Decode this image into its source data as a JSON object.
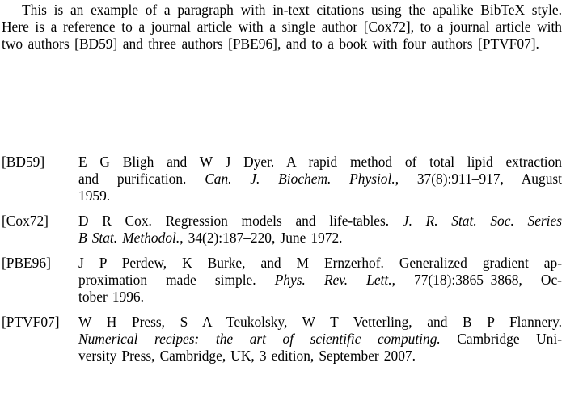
{
  "document": {
    "background_color": "#ffffff",
    "text_color": "#000000",
    "intro": {
      "text": "This is an example of a paragraph with in-text citations using the apalike BibTeX style. Here is a reference to a journal article with a single author [Cox72], to a journal article with two authors [BD59] and three authors [PBE96], and to a book with four authors [PTVF07]."
    },
    "bibliography": {
      "entries": [
        {
          "label": "[BD59]",
          "full_text": "E G Bligh and W J Dyer. A rapid method of total lipid extraction and purification. Can. J. Biochem. Physiol., 37(8):911–917, August 1959.",
          "authors": "E G Bligh and W J Dyer.",
          "title": "A rapid method of total lipid extraction and purification.",
          "journal": "Can. J. Biochem. Physiol.",
          "volume_issue_pages": "37(8):911–917",
          "date": "August 1959.",
          "lines": [
            {
              "before_italic": "E G Bligh and W J Dyer. A rapid method of total lipid extraction",
              "italic": "",
              "after_italic": ""
            },
            {
              "before_italic": "and purification. ",
              "italic": "Can. J. Biochem. Physiol.",
              "after_italic": ", 37(8):911–917, August"
            },
            {
              "before_italic": "1959.",
              "italic": "",
              "after_italic": ""
            }
          ]
        },
        {
          "label": "[Cox72]",
          "full_text": "D R Cox. Regression models and life-tables. J. R. Stat. Soc. Series B Stat. Methodol., 34(2):187–220, June 1972.",
          "authors": "D R Cox.",
          "title": "Regression models and life-tables.",
          "journal": "J. R. Stat. Soc. Series B Stat. Methodol.",
          "volume_issue_pages": "34(2):187–220",
          "date": "June 1972.",
          "lines": [
            {
              "before_italic": "D R Cox. Regression models and life-tables. ",
              "italic": "J. R. Stat. Soc. Series",
              "after_italic": ""
            },
            {
              "before_italic": "",
              "italic": "B Stat. Methodol.",
              "after_italic": ", 34(2):187–220, June 1972."
            }
          ]
        },
        {
          "label": "[PBE96]",
          "full_text": "J P Perdew, K Burke, and M Ernzerhof. Generalized gradient approximation made simple. Phys. Rev. Lett., 77(18):3865–3868, October 1996.",
          "authors": "J P Perdew, K Burke, and M Ernzerhof.",
          "title": "Generalized gradient approximation made simple.",
          "journal": "Phys. Rev. Lett.",
          "volume_issue_pages": "77(18):3865–3868",
          "date": "October 1996.",
          "lines": [
            {
              "before_italic": "J P Perdew, K Burke, and M Ernzerhof. Generalized gradient ap-",
              "italic": "",
              "after_italic": ""
            },
            {
              "before_italic": "proximation made simple. ",
              "italic": "Phys. Rev. Lett.",
              "after_italic": ", 77(18):3865–3868, Oc-"
            },
            {
              "before_italic": "tober 1996.",
              "italic": "",
              "after_italic": ""
            }
          ]
        },
        {
          "label": "[PTVF07]",
          "full_text": "W H Press, S A Teukolsky, W T Vetterling, and B P Flannery. Numerical recipes: the art of scientific computing. Cambridge University Press, Cambridge, UK, 3 edition, September 2007.",
          "authors": "W H Press, S A Teukolsky, W T Vetterling, and B P Flannery.",
          "title": "Numerical recipes: the art of scientific computing.",
          "publisher": "Cambridge University Press, Cambridge, UK",
          "edition": "3 edition",
          "date": "September 2007.",
          "lines": [
            {
              "before_italic": "W H Press, S A Teukolsky, W T Vetterling, and B P Flannery.",
              "italic": "",
              "after_italic": ""
            },
            {
              "before_italic": "",
              "italic": "Numerical recipes: the art of scientific computing.",
              "after_italic": " Cambridge Uni-"
            },
            {
              "before_italic": "versity Press, Cambridge, UK, 3 edition, September 2007.",
              "italic": "",
              "after_italic": ""
            }
          ]
        }
      ]
    }
  }
}
